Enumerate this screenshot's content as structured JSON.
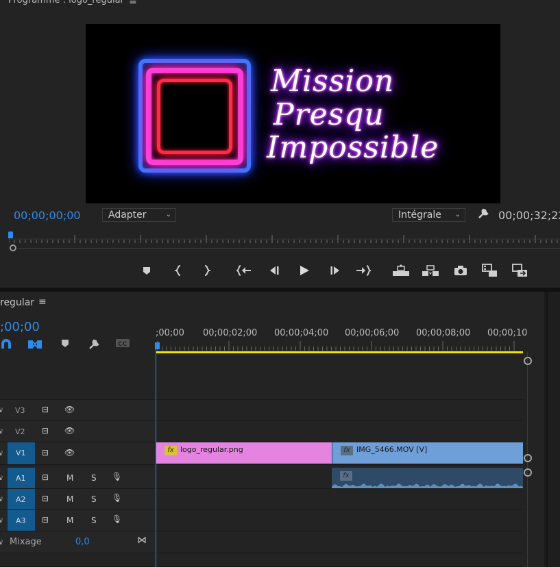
{
  "program_monitor": {
    "title": "Programme : logo_regular",
    "menu_icon": "hamburger-icon",
    "logo_text": [
      "Mission",
      "Presqu",
      "Impossible"
    ],
    "current_timecode": "00;00;00;00",
    "zoom_label": "Adapter",
    "resolution_label": "Intégrale",
    "duration_timecode": "00;00;32;22",
    "transport_icons": [
      "marker-icon",
      "mark-in-icon",
      "mark-out-icon",
      "go-to-in-icon",
      "step-back-icon",
      "play-icon",
      "step-forward-icon",
      "go-to-out-icon",
      "lift-icon",
      "extract-icon",
      "export-frame-icon",
      "insert-icon",
      "overwrite-icon"
    ]
  },
  "timeline": {
    "sequence_name": "regular",
    "timecode": ";00;00",
    "ruler_labels": [
      ";00;00",
      "00;00;02;00",
      "00;00;04;00",
      "00;00;06;00",
      "00;00;08;00",
      "00;00;10"
    ],
    "tracks": {
      "v3": "V3",
      "v2": "V2",
      "v1": "V1",
      "a1": "A1",
      "a2": "A2",
      "a3": "A3"
    },
    "mute_label": "M",
    "solo_label": "S",
    "mix_label": "Mixage",
    "mix_value": "0,0",
    "clips": {
      "logo": "logo_regular.png",
      "video": "IMG_5466.MOV [V]",
      "fx_label": "fx"
    },
    "colors": {
      "logo_clip": "#e483e0",
      "video_clip": "#6e9fd8",
      "audio_clip": "#2e4a66",
      "playhead": "#2d8ceb",
      "work_area": "#f2e200",
      "track_target": "#135a8e"
    }
  }
}
